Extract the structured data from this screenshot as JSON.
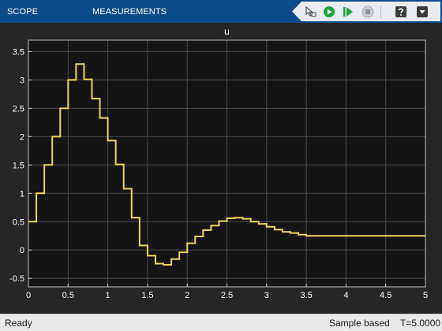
{
  "toolstrip": {
    "tabs": [
      {
        "label": "SCOPE"
      },
      {
        "label": "MEASUREMENTS"
      }
    ],
    "quick_access": [
      "ruler-arrow-icon",
      "run-icon",
      "step-forward-icon",
      "stop-icon",
      "help-icon",
      "dropdown-icon"
    ],
    "colors": {
      "background": "#0d4a8a",
      "quick_bar": "#e8ecf1",
      "run": "#1fa33a"
    }
  },
  "plot": {
    "title": "u",
    "x_ticks": [
      "0",
      "0.5",
      "1",
      "1.5",
      "2",
      "2.5",
      "3",
      "3.5",
      "4",
      "4.5",
      "5"
    ],
    "y_ticks": [
      "-0.5",
      "0",
      "0.5",
      "1",
      "1.5",
      "2",
      "2.5",
      "3",
      "3.5"
    ],
    "colors": {
      "axes_bg": "#141414",
      "grid": "#4a4a4a",
      "line": "#f2d35b",
      "text": "#ffffff"
    }
  },
  "chart_data": {
    "type": "line",
    "step": true,
    "title": "u",
    "xlabel": "",
    "ylabel": "",
    "xlim": [
      0,
      5
    ],
    "ylim": [
      -0.65,
      3.7
    ],
    "grid": true,
    "series": [
      {
        "color": "#f2d35b",
        "x": [
          0,
          0.1,
          0.2,
          0.3,
          0.4,
          0.5,
          0.6,
          0.7,
          0.8,
          0.9,
          1.0,
          1.1,
          1.2,
          1.3,
          1.4,
          1.5,
          1.6,
          1.7,
          1.8,
          1.9,
          2.0,
          2.1,
          2.2,
          2.3,
          2.4,
          2.5,
          2.6,
          2.7,
          2.8,
          2.9,
          3.0,
          3.1,
          3.2,
          3.3,
          3.4,
          3.5,
          5.0
        ],
        "y": [
          0.5,
          1.0,
          1.5,
          2.0,
          2.5,
          3.0,
          3.28,
          3.01,
          2.67,
          2.33,
          1.93,
          1.51,
          1.08,
          0.57,
          0.08,
          -0.1,
          -0.24,
          -0.26,
          -0.16,
          -0.04,
          0.12,
          0.24,
          0.35,
          0.43,
          0.51,
          0.56,
          0.57,
          0.55,
          0.5,
          0.46,
          0.41,
          0.36,
          0.32,
          0.3,
          0.27,
          0.25,
          0.25
        ]
      }
    ]
  },
  "status": {
    "left": "Ready",
    "mode": "Sample based",
    "time": "T=5.0000"
  }
}
